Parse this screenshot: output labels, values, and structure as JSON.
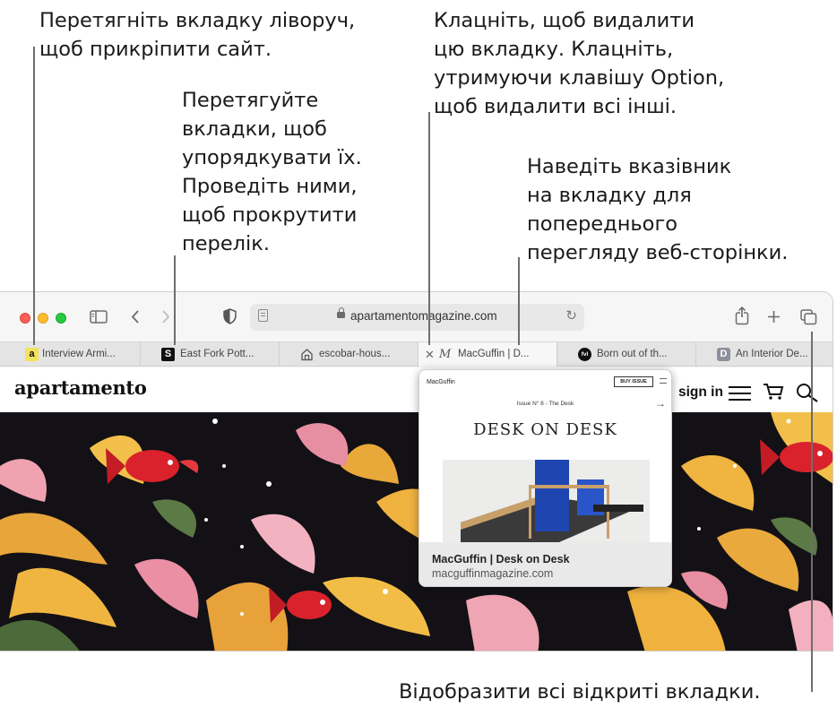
{
  "callouts": {
    "pin_tab": [
      "Перетягніть вкладку ліворуч,",
      "щоб прикріпити сайт."
    ],
    "reorder_tabs": [
      "Перетягуйте",
      "вкладки, щоб",
      "упорядкувати їх.",
      "Проведіть ними,",
      "щоб прокрутити",
      "перелік."
    ],
    "close_tab": [
      "Клацніть, щоб видалити",
      "цю вкладку. Клацніть,",
      "утримуючи клавішу Option,",
      "щоб видалити всі інші."
    ],
    "hover_preview": [
      "Наведіть вказівник",
      "на вкладку для",
      "попереднього",
      "перегляду веб-сторінки."
    ],
    "show_all_tabs": "Відобразити всі відкриті вкладки."
  },
  "toolbar": {
    "url": "apartamentomagazine.com",
    "icons": [
      "sidebar-icon",
      "back-icon",
      "forward-icon",
      "shield-icon",
      "share-icon",
      "new-tab-icon",
      "tab-overview-icon"
    ]
  },
  "tabs": [
    {
      "label": "Interview Armi...",
      "favicon": "a",
      "fav_bg": "#f2e35c",
      "fav_fg": "#111"
    },
    {
      "label": "East Fork Pott...",
      "favicon": "S",
      "fav_bg": "#111111",
      "fav_fg": "#fff"
    },
    {
      "label": "escobar-hous...",
      "favicon": "",
      "fav_bg": "transparent",
      "fav_fg": "#555"
    },
    {
      "label": "MacGuffin | D...",
      "favicon": "M",
      "fav_bg": "transparent",
      "fav_fg": "#555"
    },
    {
      "label": "Born out of th...",
      "favicon": "fvl",
      "fav_bg": "#111111",
      "fav_fg": "#fff"
    },
    {
      "label": "An Interior De...",
      "favicon": "D",
      "fav_bg": "#8d8f9c",
      "fav_fg": "#fff"
    }
  ],
  "site": {
    "logo": "apartamento",
    "signin": "sign in"
  },
  "preview": {
    "brand": "MacGuffin",
    "buy": "BUY ISSUE",
    "issue": "Issue N° 8 - The Desk",
    "headline": "DESK ON DESK",
    "title": "MacGuffin | Desk on Desk",
    "url": "macguffinmagazine.com"
  }
}
